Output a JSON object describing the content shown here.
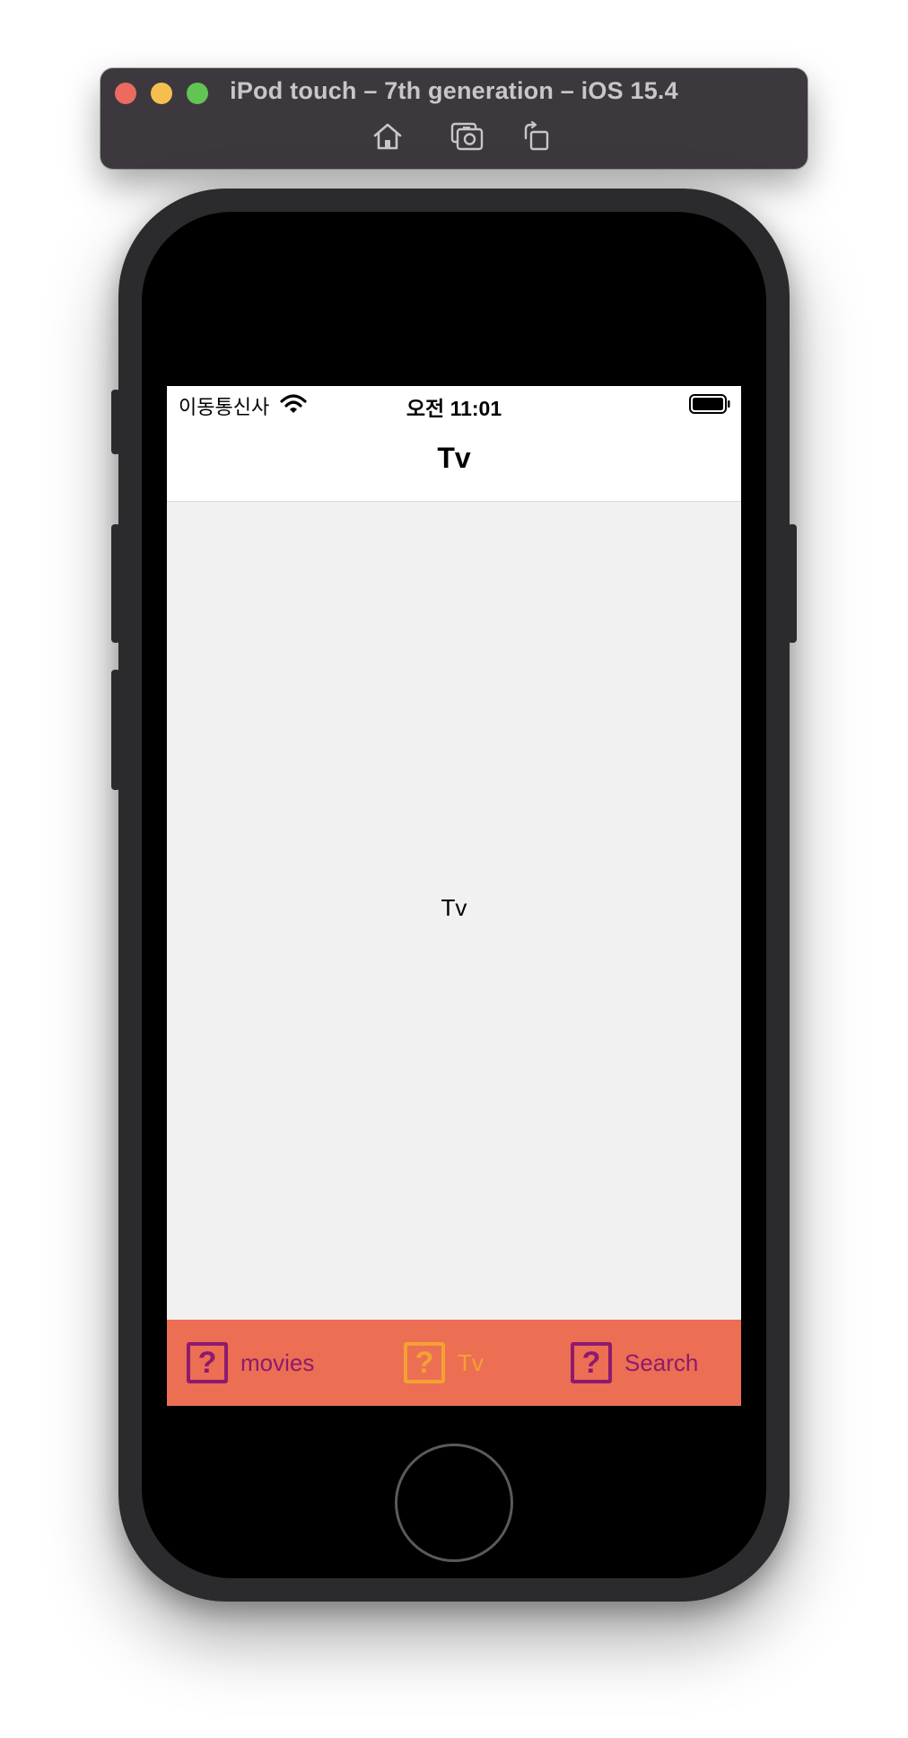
{
  "simulator": {
    "title": "iPod touch – 7th generation – iOS 15.4",
    "toolbar": [
      {
        "icon": "home-icon",
        "label": "Home"
      },
      {
        "icon": "screenshot-icon",
        "label": "Screenshot"
      },
      {
        "icon": "rotate-icon",
        "label": "Rotate"
      }
    ]
  },
  "status_bar": {
    "carrier": "이동통신사",
    "time": "오전 11:01"
  },
  "nav": {
    "title": "Tv"
  },
  "content": {
    "label": "Tv"
  },
  "tab_bar": {
    "background": "#ec6e53",
    "active_color": "#f4a131",
    "inactive_color": "#8e1a6e",
    "tabs": [
      {
        "label": "movies",
        "icon": "question-icon",
        "selected": false
      },
      {
        "label": "Tv",
        "icon": "question-icon",
        "selected": true
      },
      {
        "label": "Search",
        "icon": "question-icon",
        "selected": false
      }
    ],
    "icon_glyph": "?"
  }
}
